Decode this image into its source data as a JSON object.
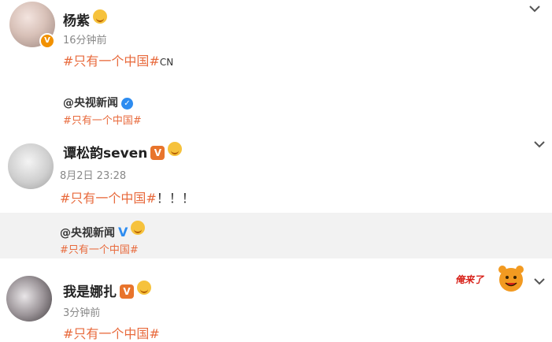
{
  "posts": [
    {
      "username": "杨紫",
      "time": "16分钟前",
      "content_tag": "#只有一个中国#",
      "content_extra": "CN",
      "quote_user": "@央视新闻",
      "quote_tag": "#只有一个中国#"
    },
    {
      "username": "谭松韵seven",
      "time": "8月2日 23:28",
      "content_tag": "#只有一个中国#",
      "content_extra": "！！！",
      "quote_user": "@央视新闻",
      "quote_tag": "#只有一个中国#"
    },
    {
      "username": "我是娜扎",
      "time": "3分钟前",
      "content_tag": "#只有一个中国#",
      "sticker_text": "俺来了"
    }
  ],
  "icons": {
    "collapse": "chevron-down-icon",
    "verified": "verified-badge-icon",
    "vip": "vip-v-icon",
    "emoji": "emoji-icon",
    "sticker": "sticker-icon"
  },
  "colors": {
    "topic_tag": "#e86a3c",
    "verified_blue": "#2d8cf0",
    "badge_orange": "#f29100",
    "quote_background": "#f2f2f2"
  }
}
